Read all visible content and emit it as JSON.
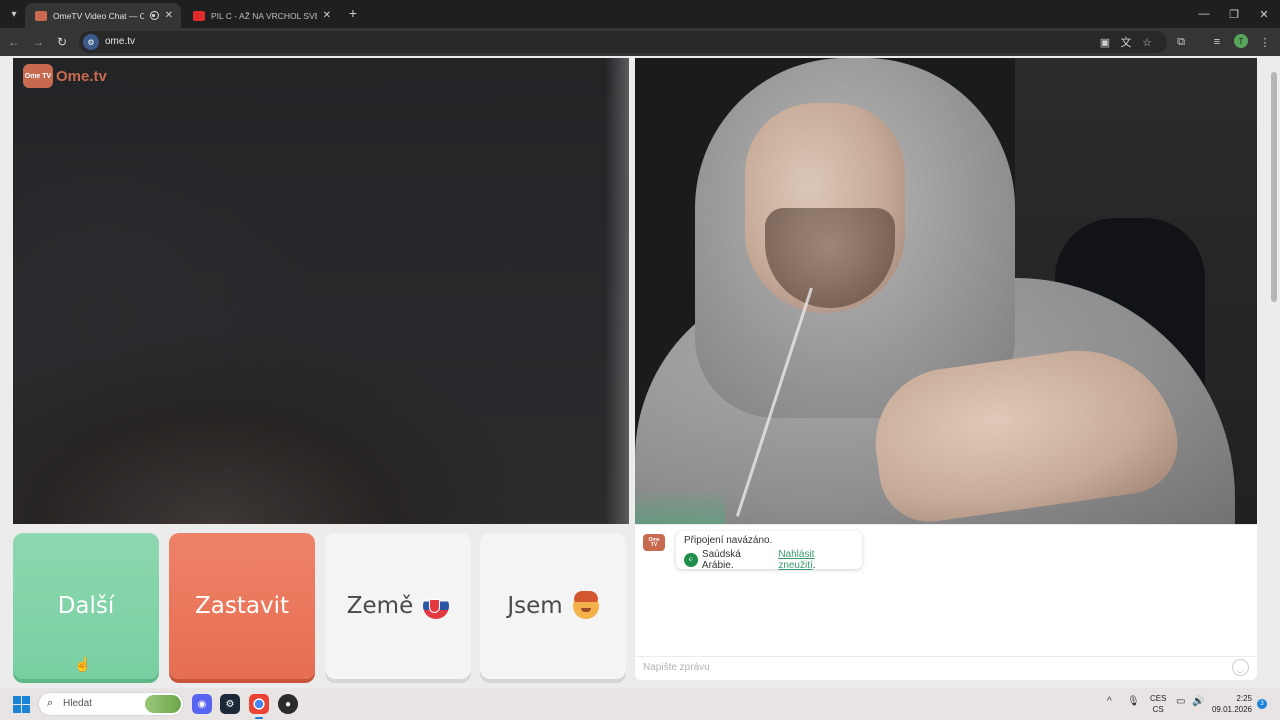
{
  "browser": {
    "tabs": [
      {
        "title": "OmeTV Video Chat — Ome",
        "active": true
      },
      {
        "title": "PIL C - AŽ NA VRCHOL SVETA",
        "active": false
      }
    ],
    "url": "ome.tv"
  },
  "brand": {
    "logo_text": "Ome.tv",
    "logo_badge": "Ome TV"
  },
  "buttons": {
    "next": "Další",
    "stop": "Zastavit",
    "country": "Země",
    "gender": "Jsem"
  },
  "chat": {
    "status": "Připojení navázáno.",
    "country": "Saúdská Arábie.",
    "report_link": "Nahlásit zneužití",
    "report_suffix": ".",
    "input_placeholder": "Napište zprávu"
  },
  "taskbar": {
    "search_label": "Hledat",
    "lang_top": "CES",
    "lang_bottom": "CS",
    "time": "2:25",
    "date": "09.01.2026",
    "notification_count": "3"
  },
  "colors": {
    "next_button": "#78cfa2",
    "stop_button": "#e66e52",
    "brand": "#c86a50",
    "report_link": "#3a9b6c"
  }
}
